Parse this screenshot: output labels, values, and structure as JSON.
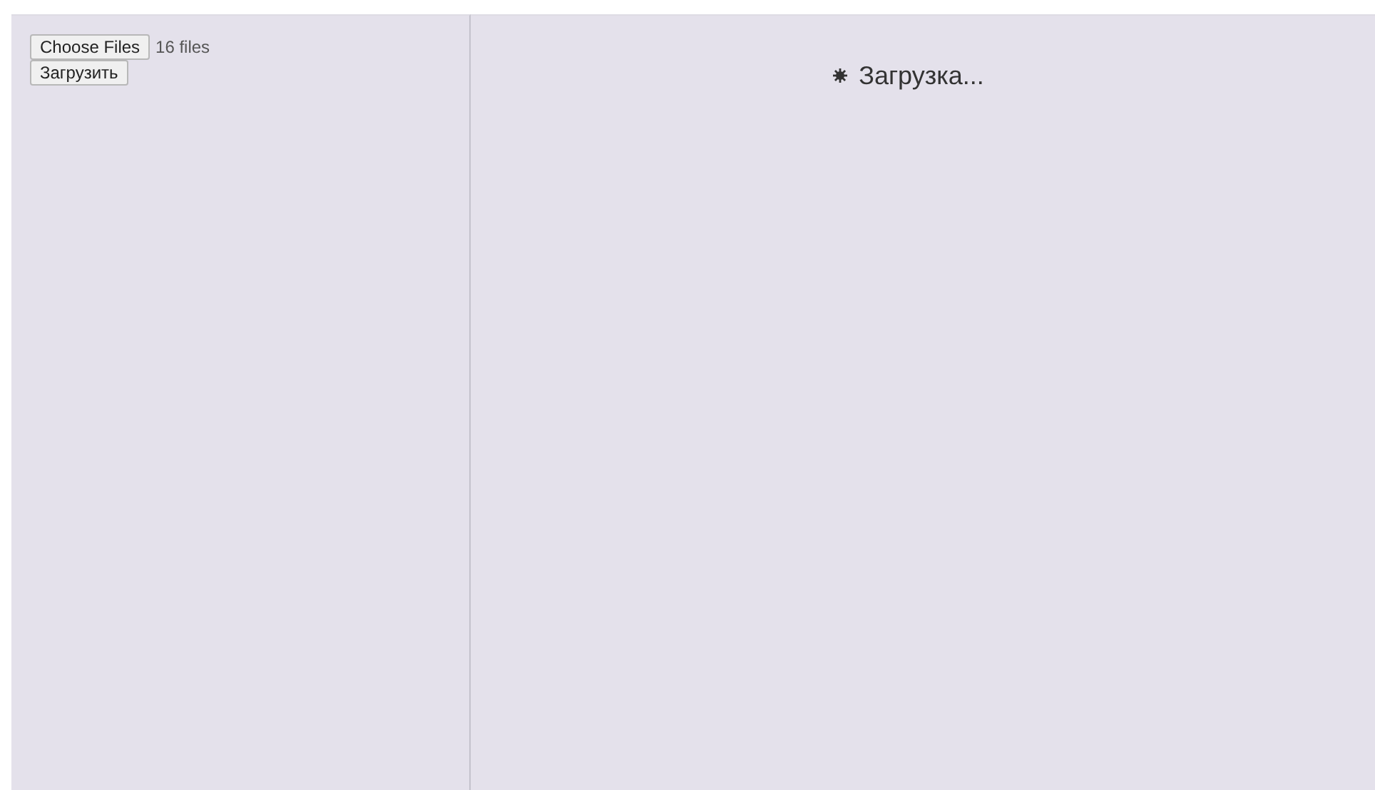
{
  "upload_panel": {
    "choose_button": "Choose Files",
    "file_count": "16 files",
    "upload_button": "Загрузить"
  },
  "status": {
    "text": "Загрузка..."
  }
}
